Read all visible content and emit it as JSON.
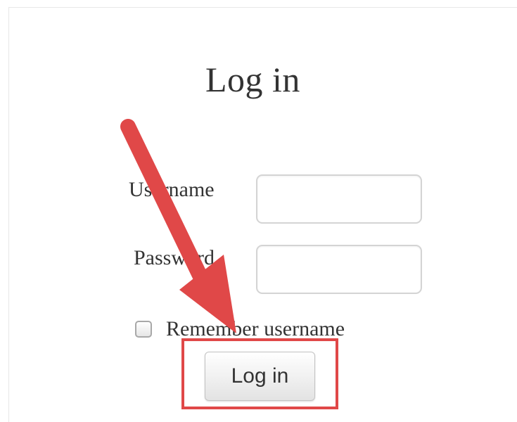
{
  "form": {
    "title": "Log in",
    "username_label": "Username",
    "password_label": "Password",
    "username_value": "",
    "password_value": "",
    "remember_label": "Remember username",
    "remember_checked": false,
    "submit_label": "Log in"
  },
  "annotation": {
    "arrow_color": "#e04848",
    "highlight_color": "#e04848"
  }
}
